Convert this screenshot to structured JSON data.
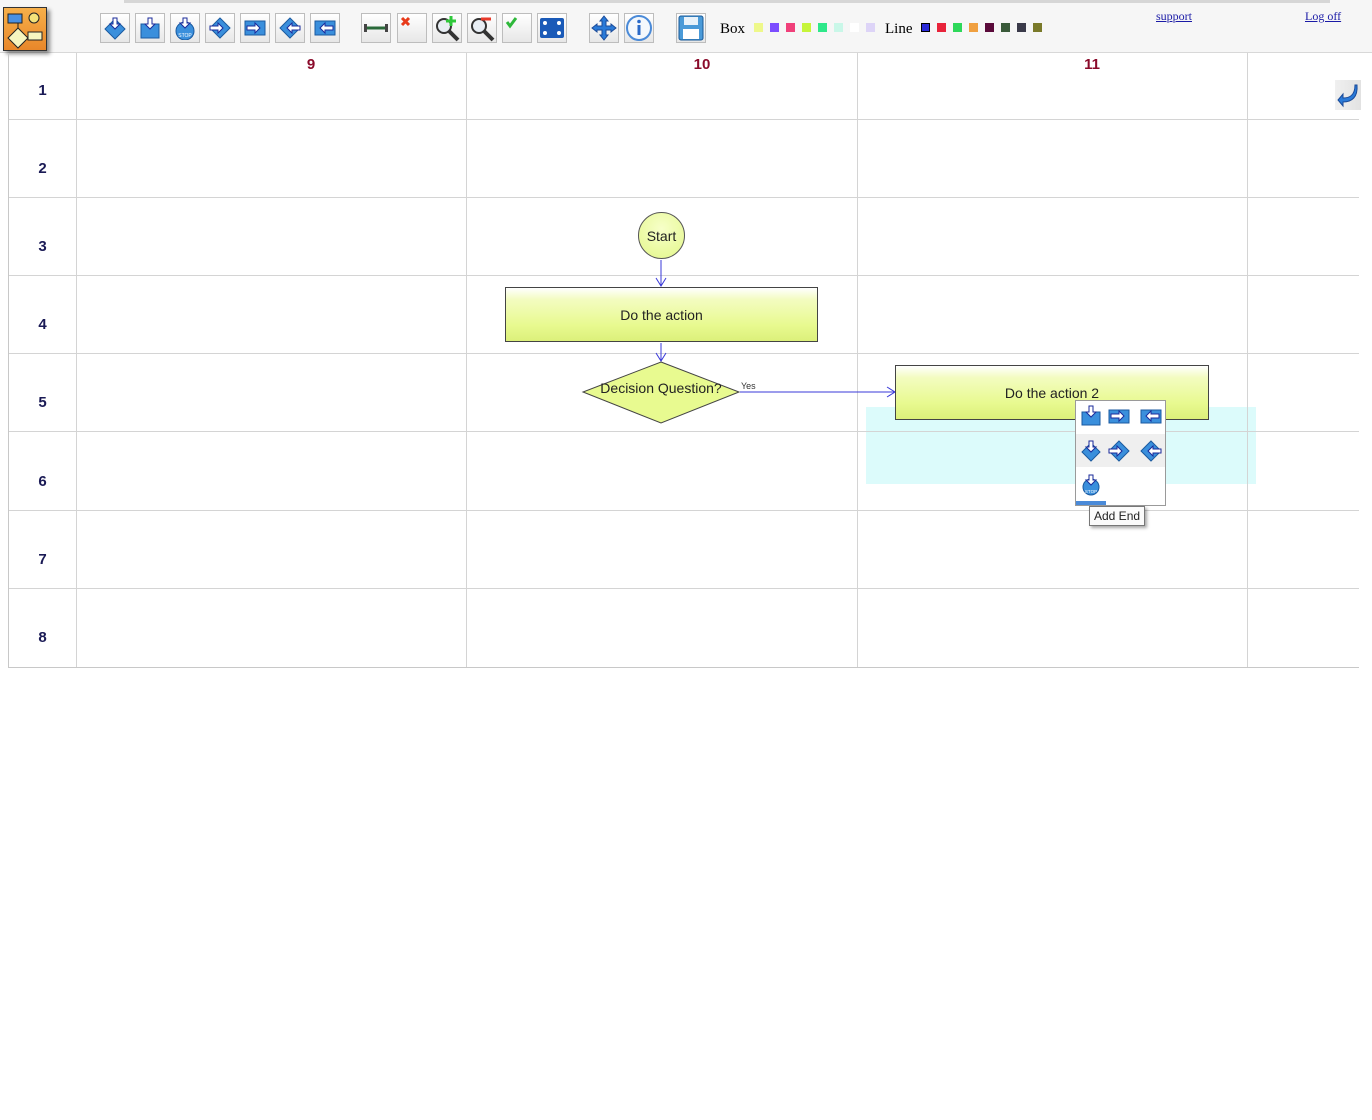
{
  "toolbar": {
    "tools": [
      {
        "name": "add-decision-below-button",
        "icon": "diamond-down-icon"
      },
      {
        "name": "add-action-below-button",
        "icon": "box-down-icon"
      },
      {
        "name": "add-end-below-button",
        "icon": "stop-down-icon"
      },
      {
        "name": "add-decision-right-button",
        "icon": "diamond-right-icon"
      },
      {
        "name": "add-action-right-button",
        "icon": "box-right-icon"
      },
      {
        "name": "add-decision-left-button",
        "icon": "diamond-left-icon"
      },
      {
        "name": "add-action-left-button",
        "icon": "box-left-icon"
      },
      {
        "name": "connect-line-button",
        "icon": "connector-icon"
      },
      {
        "name": "delete-button",
        "icon": "delete-icon"
      },
      {
        "name": "zoom-in-button",
        "icon": "zoom-in-icon"
      },
      {
        "name": "zoom-out-button",
        "icon": "zoom-out-icon"
      },
      {
        "name": "validate-button",
        "icon": "check-icon"
      },
      {
        "name": "fit-screen-button",
        "icon": "fit-icon"
      },
      {
        "name": "move-button",
        "icon": "move-icon"
      },
      {
        "name": "info-button",
        "icon": "info-icon"
      },
      {
        "name": "save-button",
        "icon": "save-icon"
      }
    ],
    "box_label": "Box",
    "line_label": "Line",
    "box_colors": [
      "#eef88a",
      "#7c4dff",
      "#f0407a",
      "#c6f53a",
      "#2ee88a",
      "#c9f7e8",
      "#ffffff",
      "#ddd4f7"
    ],
    "line_colors": [
      "#2a2ad8",
      "#e8233a",
      "#2ed85a",
      "#f0a040",
      "#5a0a3a",
      "#3a5a3a",
      "#3a3a4a",
      "#7a7a2a"
    ],
    "support_link": "support",
    "logoff_link": "Log off"
  },
  "grid": {
    "columns": [
      "9",
      "10",
      "11"
    ],
    "rows": [
      "1",
      "2",
      "3",
      "4",
      "5",
      "6",
      "7",
      "8"
    ]
  },
  "flowchart": {
    "start_label": "Start",
    "action1_label": "Do the action",
    "decision_label": "Decision Question?",
    "yes_label": "Yes",
    "action2_label": "Do the action 2",
    "box_fill": "#e8fa90",
    "line_color": "#3a3ad8"
  },
  "popup": {
    "tooltip": "Add End"
  }
}
